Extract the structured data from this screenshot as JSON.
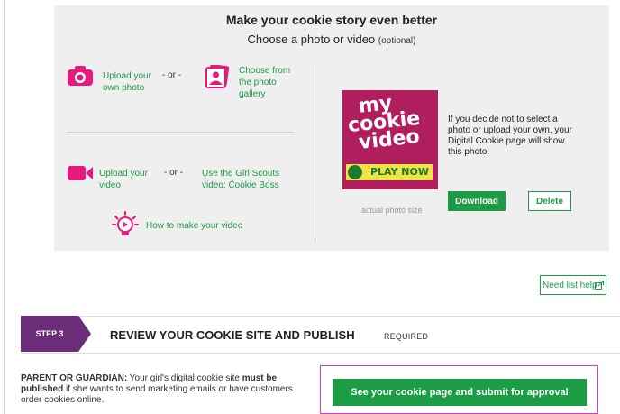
{
  "story": {
    "title": "Make your cookie story even better",
    "subtitle": "Choose a photo or video",
    "optional": "(optional)",
    "or_label": "- or -",
    "upload_photo": [
      "Upload your",
      "own photo"
    ],
    "choose_gallery": [
      "Choose from",
      "the photo",
      "gallery"
    ],
    "upload_video": [
      "Upload your",
      "video"
    ],
    "use_video": [
      "Use the Girl Scouts",
      "video: Cookie Boss"
    ],
    "how_to": "How to make your video",
    "thumbnail_text": [
      "my",
      "cookie",
      "video"
    ],
    "thumbnail_play": "PLAY NOW",
    "photo_caption": "actual photo size",
    "photo_info": "If you decide not to select a photo or upload your own, your Digital Cookie page will show this photo.",
    "download_label": "Download",
    "delete_label": "Delete"
  },
  "help": {
    "label": "Need list help"
  },
  "step3": {
    "badge": "STEP 3",
    "title": "REVIEW YOUR COOKIE SITE AND PUBLISH",
    "required": "REQUIRED"
  },
  "parent_note": {
    "lead": "PARENT OR GUARDIAN:",
    "text1": " Your girl's digital cookie site ",
    "must": "must be published",
    "text2": " if she wants to send marketing emails or have customers order cookies online."
  },
  "submit": {
    "label": "See your cookie page and submit for approval"
  },
  "colors": {
    "green": "#1d9c46",
    "pink": "#e8197d",
    "purple": "#6b2c7a",
    "panel": "#efefef"
  },
  "icons": [
    "camera-icon",
    "gallery-icon",
    "video-camera-icon",
    "lightbulb-icon",
    "external-link-icon"
  ]
}
